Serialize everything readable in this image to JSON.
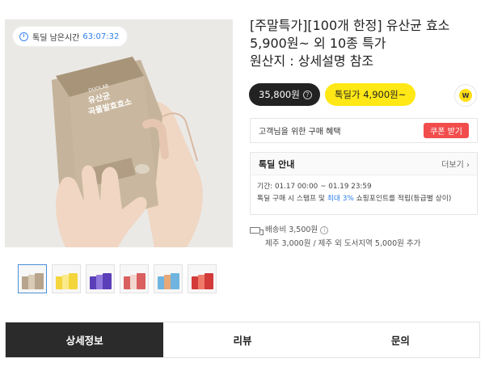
{
  "timer": {
    "label": "톡딜 남은시간",
    "value": "63:07:32"
  },
  "product": {
    "title_lines": [
      "[주말특가][100개 한정] 유산균 효소",
      "5,900원~ 외 10종 특가",
      "원산지 : 상세설명 참조"
    ],
    "box_brand": "DUOLAB",
    "box_name_line1": "유산균",
    "box_name_line2": "곡물발효효소"
  },
  "price": {
    "regular": "35,800원",
    "talkdeal": "톡딜가 4,900원~",
    "badge": "W"
  },
  "coupon": {
    "text": "고객님을 위한 구매 혜택",
    "button": "쿠폰 받기"
  },
  "deal": {
    "heading": "톡딜 안내",
    "more": "더보기",
    "period": "기간: 01.17 00:00 ~ 01.19 23:59",
    "benefit_prefix": "톡딜 구매 시 스탬프 및 ",
    "benefit_highlight": "최대 3%",
    "benefit_suffix": " 쇼핑포인트를 적립(등급별 상이)"
  },
  "shipping": {
    "fee": "배송비 3,500원",
    "extra": "제주 3,000원 / 제주 외 도서지역 5,000원 추가"
  },
  "thumbnails": [
    {
      "color": "#b7a48c",
      "accent": "#d9cbb6"
    },
    {
      "color": "#f4d63c",
      "accent": "#fbe98a"
    },
    {
      "color": "#5a3fb8",
      "accent": "#8f78dc"
    },
    {
      "color": "#d9605f",
      "accent": "#f2d7d0"
    },
    {
      "color": "#6fb5e0",
      "accent": "#e8a878"
    },
    {
      "color": "#d33a3a",
      "accent": "#f07a6a"
    }
  ],
  "tabs": [
    {
      "label": "상세정보",
      "active": true
    },
    {
      "label": "리뷰",
      "active": false
    },
    {
      "label": "문의",
      "active": false
    }
  ]
}
